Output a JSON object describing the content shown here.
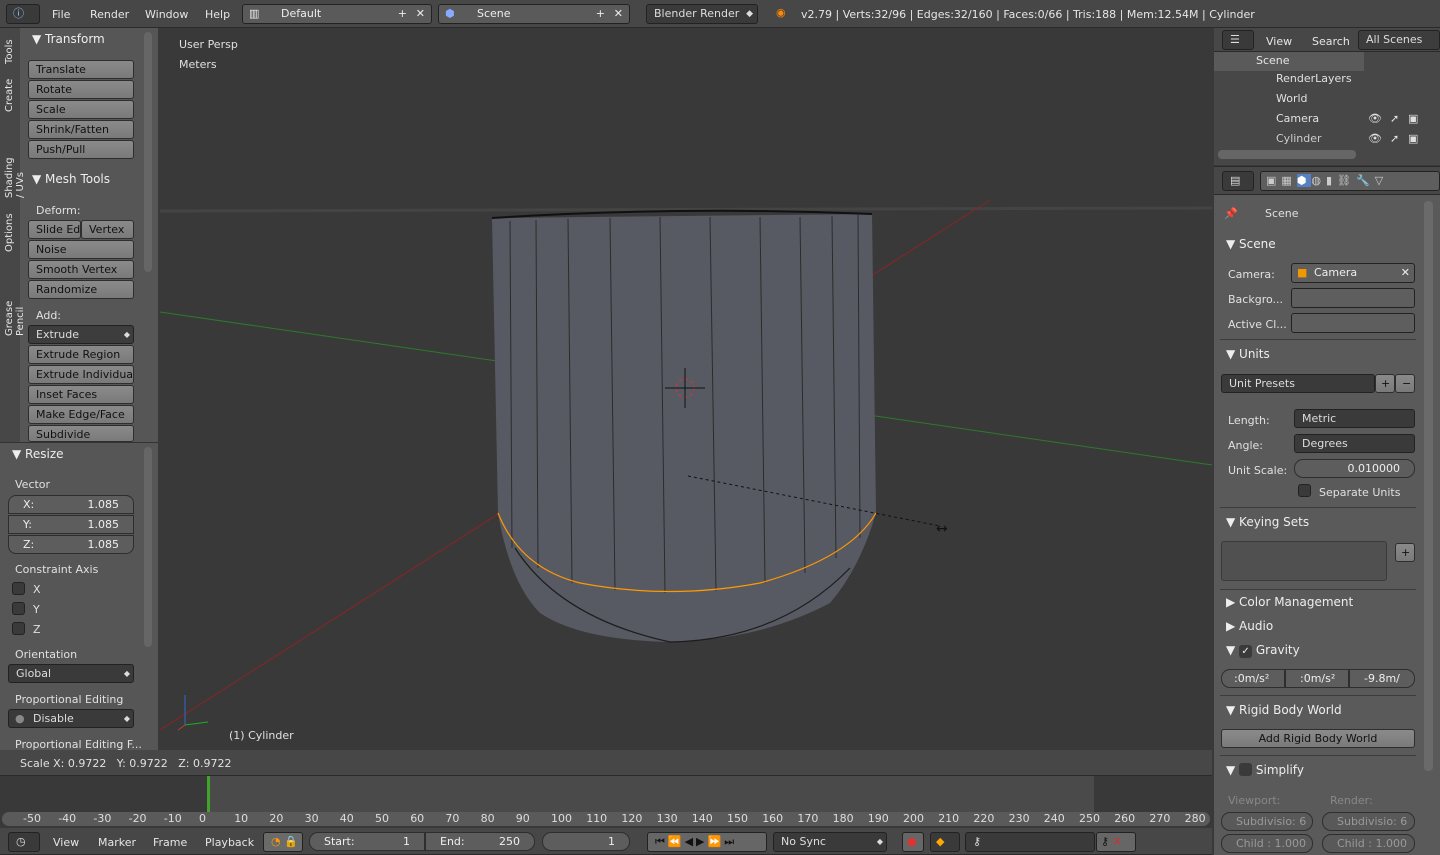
{
  "topbar": {
    "menus": [
      "File",
      "Render",
      "Window",
      "Help"
    ],
    "layout": "Default",
    "scene": "Scene",
    "engine": "Blender Render",
    "stats": "v2.79 | Verts:32/96 | Edges:32/160 | Faces:0/66 | Tris:188 | Mem:12.54M | Cylinder"
  },
  "toolshelf": {
    "tabs": [
      "Tools",
      "Create",
      "Shading / UVs",
      "Options",
      "Grease Pencil"
    ],
    "transform": {
      "title": "Transform",
      "buttons": [
        "Translate",
        "Rotate",
        "Scale",
        "Shrink/Fatten",
        "Push/Pull"
      ]
    },
    "mesh_tools": {
      "title": "Mesh Tools",
      "deform_label": "Deform:",
      "slide_edge": "Slide Ed",
      "vertex": "Vertex",
      "deform_buttons": [
        "Noise",
        "Smooth Vertex",
        "Randomize"
      ],
      "add_label": "Add:",
      "extrude": "Extrude",
      "add_buttons": [
        "Extrude Region",
        "Extrude Individual",
        "Inset Faces",
        "Make Edge/Face",
        "Subdivide"
      ]
    }
  },
  "operator": {
    "title": "Resize",
    "vector_label": "Vector",
    "vector": [
      {
        "axis": "X:",
        "value": "1.085"
      },
      {
        "axis": "Y:",
        "value": "1.085"
      },
      {
        "axis": "Z:",
        "value": "1.085"
      }
    ],
    "constraint_label": "Constraint Axis",
    "constraint": [
      "X",
      "Y",
      "Z"
    ],
    "orientation_label": "Orientation",
    "orientation": "Global",
    "prop_label": "Proportional Editing",
    "prop_value": "Disable",
    "prop_falloff_label": "Proportional Editing F..."
  },
  "viewport": {
    "view_name": "User Persp",
    "units": "Meters",
    "object_label": "(1) Cylinder",
    "status": "Scale X: 0.9722   Y: 0.9722   Z: 0.9722"
  },
  "outliner": {
    "menus": [
      "View",
      "Search"
    ],
    "filter": "All Scenes",
    "items": [
      "Scene",
      "RenderLayers",
      "World",
      "Camera",
      "Cylinder"
    ]
  },
  "properties": {
    "context": "Scene",
    "scene_panel": {
      "title": "Scene",
      "camera_label": "Camera:",
      "camera": "Camera",
      "background_label": "Backgro...",
      "active_clip_label": "Active Cl..."
    },
    "units_panel": {
      "title": "Units",
      "presets": "Unit Presets",
      "length_label": "Length:",
      "length": "Metric",
      "angle_label": "Angle:",
      "angle": "Degrees",
      "scale_label": "Unit Scale:",
      "scale": "0.010000",
      "separate": "Separate Units"
    },
    "keying_sets": "Keying Sets",
    "color_management": "Color Management",
    "audio": "Audio",
    "gravity": {
      "title": "Gravity",
      "values": [
        ":0m/s²",
        ":0m/s²",
        "-9.8m/"
      ]
    },
    "rigid_body": {
      "title": "Rigid Body World",
      "button": "Add Rigid Body World"
    },
    "simplify": {
      "title": "Simplify",
      "viewport_label": "Viewport:",
      "render_label": "Render:",
      "subdiv": "Subdivisio: 6",
      "child": "Child : 1.000"
    }
  },
  "timeline": {
    "ticks": [
      "-50",
      "-40",
      "-30",
      "-20",
      "-10",
      "0",
      "10",
      "20",
      "30",
      "40",
      "50",
      "60",
      "70",
      "80",
      "90",
      "100",
      "110",
      "120",
      "130",
      "140",
      "150",
      "160",
      "170",
      "180",
      "190",
      "200",
      "210",
      "220",
      "230",
      "240",
      "250",
      "260",
      "270",
      "280"
    ],
    "menus": [
      "View",
      "Marker",
      "Frame",
      "Playback"
    ],
    "start_label": "Start:",
    "start": "1",
    "end_label": "End:",
    "end": "250",
    "current": "1",
    "sync": "No Sync",
    "current_frame_color": "#3fa52a"
  },
  "colors": {
    "viewport": "#393939",
    "selected_edge": "#ff9900",
    "x_axis": "#8b2424",
    "y_axis": "#2c7a2c"
  }
}
